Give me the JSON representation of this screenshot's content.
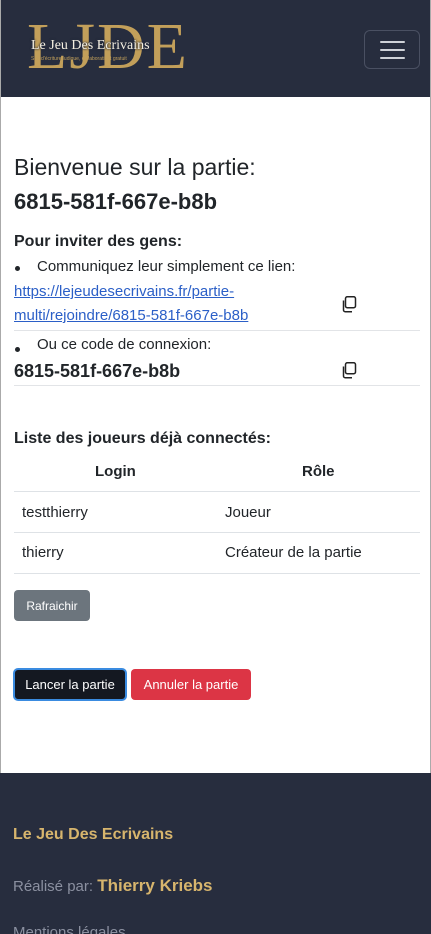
{
  "navbar": {
    "logo_letters": "LJDE",
    "logo_band": "Le Jeu  Des Ecrivains",
    "logo_small": "Site d'écriture ludique, collaboratif et gratuit",
    "toggle_icon": "menu-icon"
  },
  "main": {
    "welcome": "Bienvenue sur la partie:",
    "game_code": "6815-581f-667e-b8b",
    "invite_title": "Pour inviter des gens:",
    "invite_link_label": "Communiquez leur simplement ce lien:",
    "invite_link": "https://lejeudesecrivains.fr/partie-multi/rejoindre/6815-581f-667e-b8b",
    "connect_code_label": "Ou ce code de connexion:",
    "connect_code": "6815-581f-667e-b8b",
    "copy_icon": "copy-icon",
    "players_title": "Liste des joueurs déjà connectés:",
    "table": {
      "headers": [
        "Login",
        "Rôle"
      ],
      "rows": [
        {
          "login": "testthierry",
          "role": "Joueur"
        },
        {
          "login": "thierry",
          "role": "Créateur de la partie"
        }
      ]
    },
    "refresh_label": "Rafraichir",
    "launch_label": "Lancer la partie",
    "cancel_label": "Annuler la partie"
  },
  "footer": {
    "title": "Le Jeu Des Ecrivains",
    "made_by_label": "Réalisé par:",
    "author": "Thierry Kriebs",
    "mentions": "Mentions légales"
  },
  "colors": {
    "navbar_bg": "#272d3e",
    "gold": "#c29f5a",
    "link": "#2b5fc7",
    "secondary": "#6c757d",
    "danger": "#dc3545"
  }
}
